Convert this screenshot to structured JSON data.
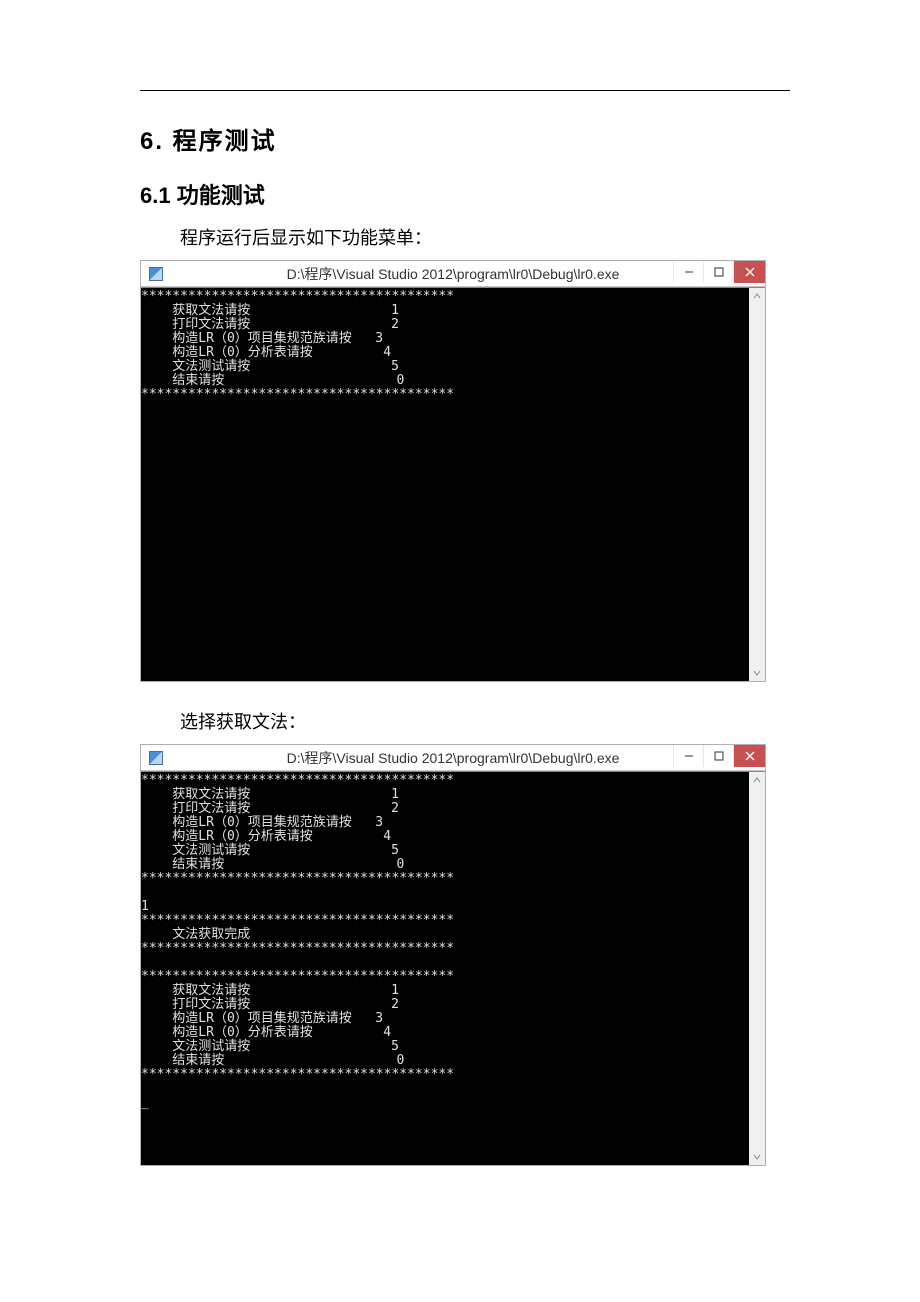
{
  "headings": {
    "section": "6.  程序测试",
    "sub": "6.1 功能测试"
  },
  "paragraphs": {
    "p1": "程序运行后显示如下功能菜单：",
    "p2": "选择获取文法："
  },
  "window": {
    "title": "D:\\程序\\Visual Studio 2012\\program\\lr0\\Debug\\lr0.exe"
  },
  "menu": {
    "border": "****************************************",
    "items": [
      {
        "label": "获取文法请按",
        "key": "1"
      },
      {
        "label": "打印文法请按",
        "key": "2"
      },
      {
        "label": "构造LR（0）项目集规范族请按",
        "key": "3"
      },
      {
        "label": "构造LR（0）分析表请按",
        "key": "4"
      },
      {
        "label": "文法测试请按",
        "key": "5"
      },
      {
        "label": "结束请按",
        "key": "0"
      }
    ]
  },
  "run2": {
    "input": "1",
    "result_line": "    文法获取完成",
    "cursor": "_"
  }
}
